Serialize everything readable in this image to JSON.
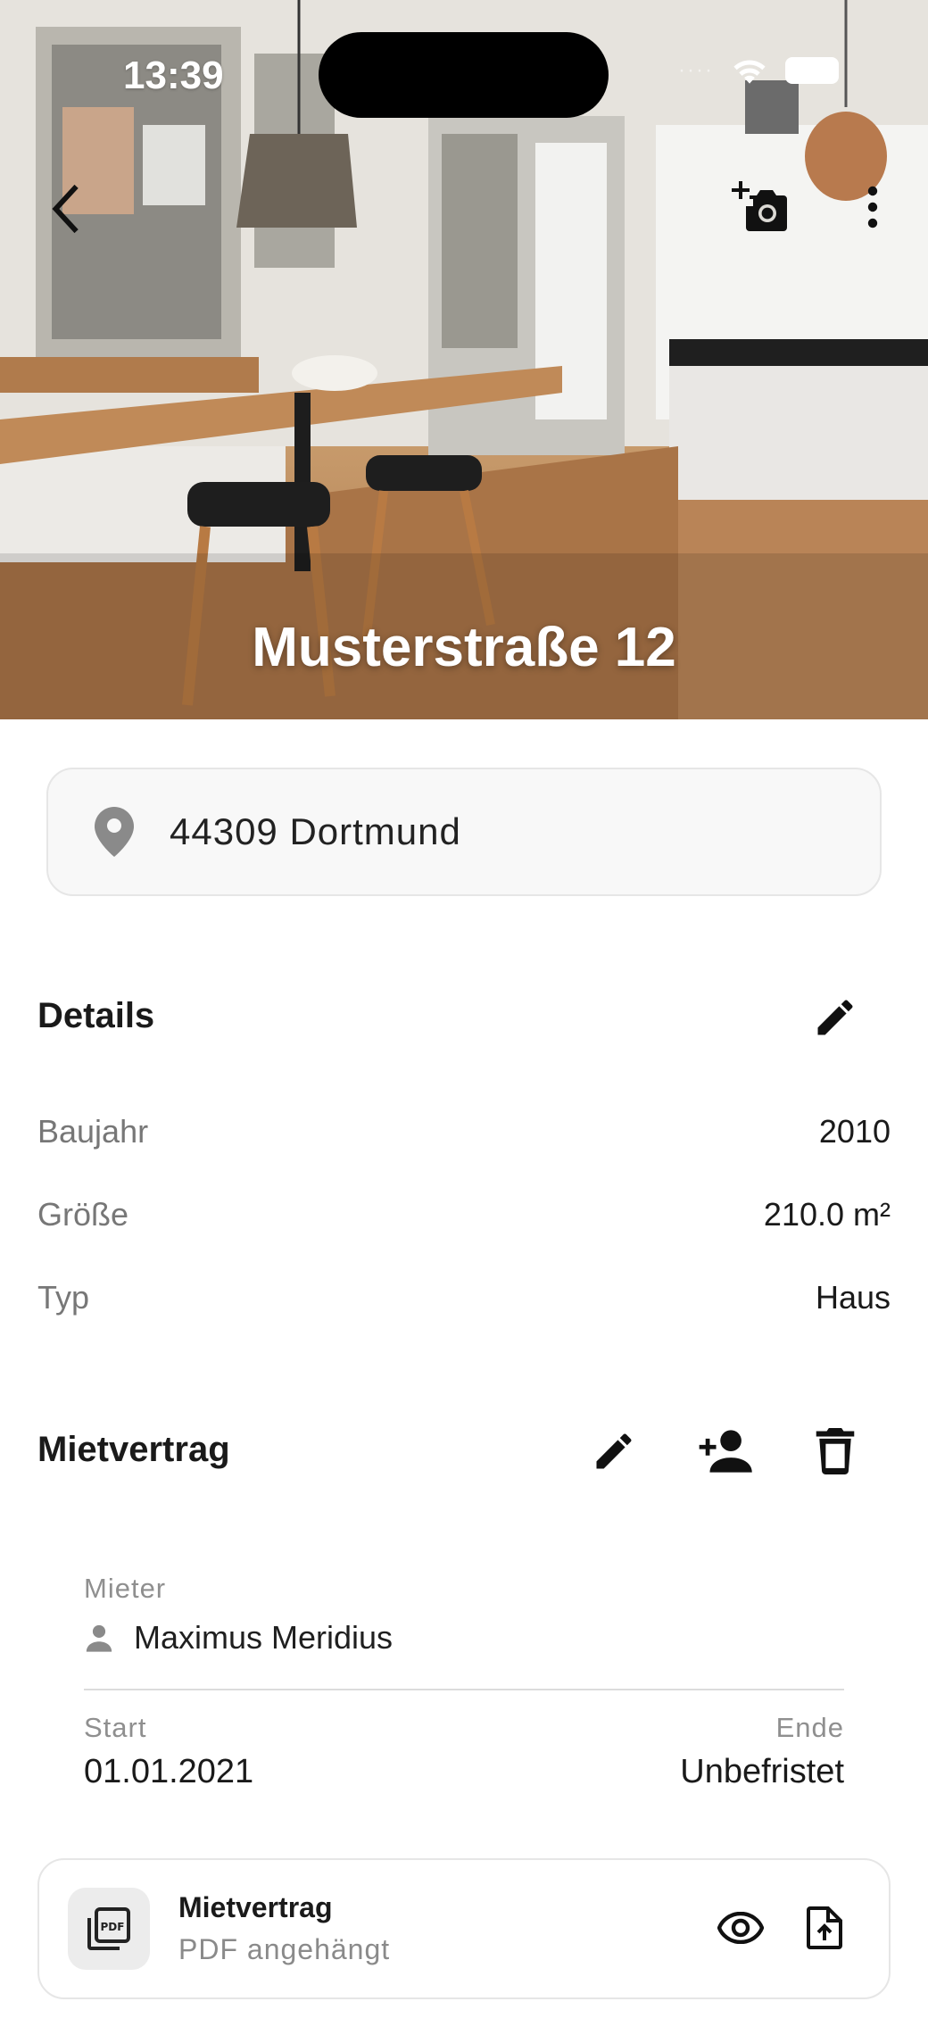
{
  "status_bar": {
    "time": "13:39",
    "dots": "····"
  },
  "hero": {
    "title": "Musterstraße 12"
  },
  "icons": {
    "back": "chevron-left-icon",
    "camera": "add-photo-icon",
    "more": "more-vert-icon",
    "location": "location-pin-icon",
    "edit": "pencil-icon",
    "add_person": "person-add-icon",
    "delete": "trash-icon",
    "person": "person-icon",
    "pdf": "pdf-file-icon",
    "view": "eye-icon",
    "upload": "file-upload-icon"
  },
  "location": {
    "text": "44309 Dortmund"
  },
  "details": {
    "title": "Details",
    "rows": [
      {
        "label": "Baujahr",
        "value": "2010"
      },
      {
        "label": "Größe",
        "value": "210.0 m²"
      },
      {
        "label": "Typ",
        "value": "Haus"
      }
    ]
  },
  "lease": {
    "title": "Mietvertrag",
    "tenant_label": "Mieter",
    "tenant_name": "Maximus Meridius",
    "start_label": "Start",
    "start_value": "01.01.2021",
    "end_label": "Ende",
    "end_value": "Unbefristet",
    "document": {
      "title": "Mietvertrag",
      "subtitle": "PDF angehängt"
    }
  },
  "colors": {
    "text": "#1a1a1a",
    "muted": "#777777",
    "card_border": "#e6e6e6",
    "icon": "#111111"
  }
}
